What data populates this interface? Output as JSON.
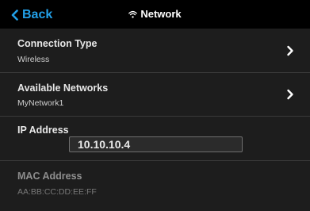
{
  "header": {
    "back_label": "Back",
    "title": "Network",
    "title_icon": "wifi-icon"
  },
  "rows": {
    "connection_type": {
      "label": "Connection Type",
      "value": "Wireless"
    },
    "available_networks": {
      "label": "Available Networks",
      "value": "MyNetwork1"
    },
    "ip_address": {
      "label": "IP Address",
      "value": "10.10.10.4"
    },
    "mac_address": {
      "label": "MAC Address",
      "value": "AA:BB:CC:DD:EE:FF"
    }
  },
  "colors": {
    "accent": "#22a0e8",
    "background": "#000000",
    "panel": "#1d1d1d"
  }
}
